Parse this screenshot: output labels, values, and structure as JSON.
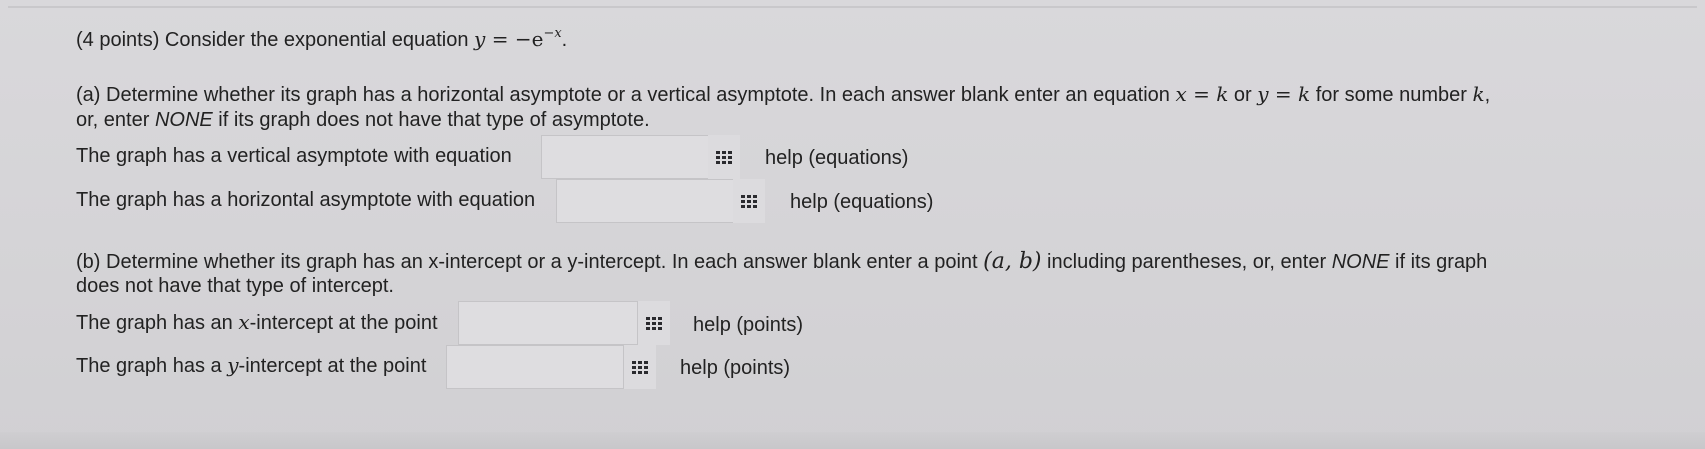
{
  "problem": {
    "header_prefix": "(4 points) Consider the exponential equation ",
    "header_math_y": "y",
    "header_math_eq": " = −e",
    "header_math_exp": "−x",
    "header_period": "."
  },
  "part_a": {
    "intro_1": "(a) Determine whether its graph has a horizontal asymptote or a vertical asymptote. In each answer blank enter an equation ",
    "intro_math_1": "x = k",
    "intro_or": " or ",
    "intro_math_2": "y = k",
    "intro_2": " for some number ",
    "intro_math_3": "k",
    "intro_3": ",",
    "intro_line2": "or, enter ",
    "intro_none": "NONE",
    "intro_line2_end": " if its graph does not have that type of asymptote.",
    "vertical_label": "The graph has a vertical asymptote with equation",
    "vertical_value": "",
    "vertical_help": "help (equations)",
    "horizontal_label": "The graph has a horizontal asymptote with equation",
    "horizontal_value": "",
    "horizontal_help": "help (equations)"
  },
  "part_b": {
    "intro_1": "(b) Determine whether its graph has an x-intercept or a y-intercept. In each answer blank enter a point ",
    "intro_math": "(a, b)",
    "intro_2": " including parentheses, or, enter ",
    "intro_none": "NONE",
    "intro_3": " if its graph",
    "intro_line2": "does not have that type of intercept.",
    "x_label_1": "The graph has an ",
    "x_label_math": "x",
    "x_label_2": "-intercept at the point",
    "x_value": "",
    "x_help": "help (points)",
    "y_label_1": "The graph has a ",
    "y_label_math": "y",
    "y_label_2": "-intercept at the point",
    "y_value": "",
    "y_help": "help (points)"
  }
}
